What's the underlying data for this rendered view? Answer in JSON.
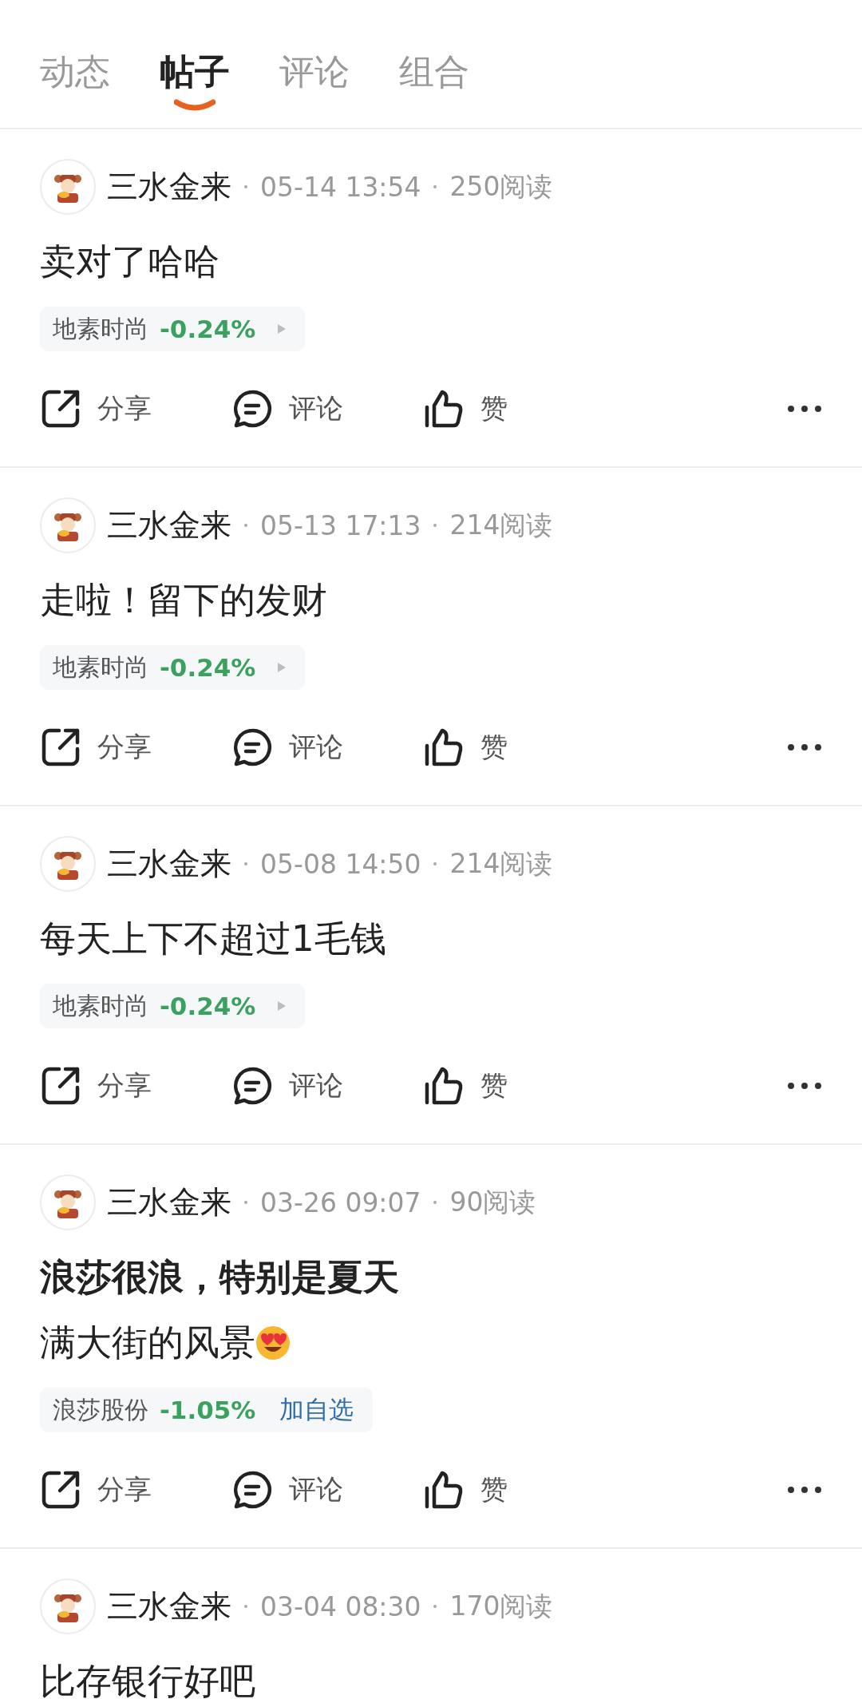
{
  "tabs": [
    {
      "label": "动态",
      "selected": false
    },
    {
      "label": "帖子",
      "selected": true
    },
    {
      "label": "评论",
      "selected": false
    },
    {
      "label": "组合",
      "selected": false
    }
  ],
  "posts": [
    {
      "author": "三水金来",
      "time": "05-14 13:54",
      "reads": "250阅读",
      "title": "卖对了哈哈",
      "stock": {
        "name": "地素时尚",
        "change": "-0.24%"
      },
      "actions": [
        "分享",
        "评论",
        "赞"
      ]
    },
    {
      "author": "三水金来",
      "time": "05-13 17:13",
      "reads": "214阅读",
      "title": "走啦！留下的发财",
      "stock": {
        "name": "地素时尚",
        "change": "-0.24%"
      },
      "actions": [
        "分享",
        "评论",
        "赞"
      ]
    },
    {
      "author": "三水金来",
      "time": "05-08 14:50",
      "reads": "214阅读",
      "title": "每天上下不超过1毛钱",
      "stock": {
        "name": "地素时尚",
        "change": "-0.24%"
      },
      "actions": [
        "分享",
        "评论",
        "赞"
      ]
    },
    {
      "author": "三水金来",
      "time": "03-26 09:07",
      "reads": "90阅读",
      "title": "浪莎很浪，特别是夏天",
      "title_bold": true,
      "body": "满大街的风景",
      "body_emoji": true,
      "stock": {
        "name": "浪莎股份",
        "change": "-1.05%",
        "action": "加自选"
      },
      "actions": [
        "分享",
        "评论",
        "赞"
      ]
    },
    {
      "author": "三水金来",
      "time": "03-04 08:30",
      "reads": "170阅读",
      "title": "比存银行好吧"
    }
  ]
}
